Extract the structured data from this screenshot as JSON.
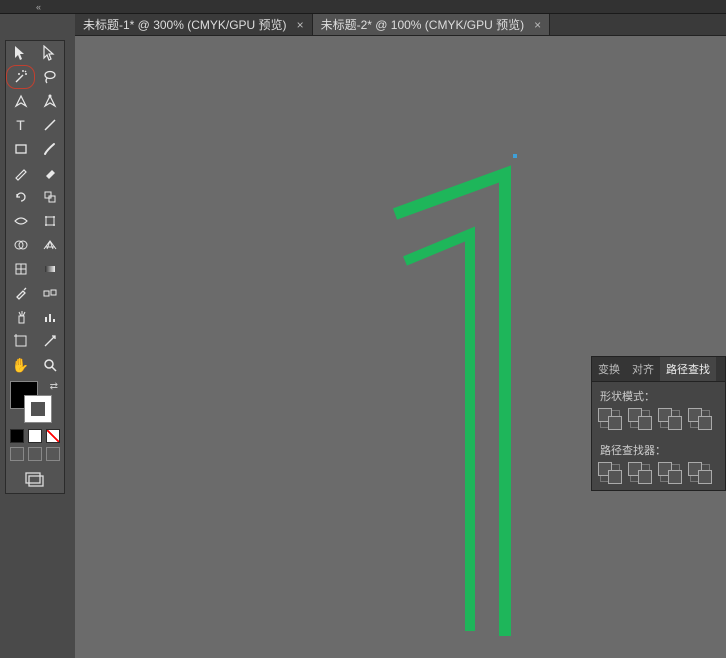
{
  "tabs": [
    {
      "label": "未标题-1* @ 300% (CMYK/GPU 预览)",
      "active": false
    },
    {
      "label": "未标题-2* @ 100% (CMYK/GPU 预览)",
      "active": true
    }
  ],
  "tools": {
    "selection": "selection-tool",
    "direct_select": "direct-selection-tool",
    "magic_wand": "magic-wand-tool",
    "lasso": "lasso-tool",
    "pen": "pen-tool",
    "curvature": "curvature-tool",
    "type": "type-tool",
    "line": "line-segment-tool",
    "rectangle": "rectangle-tool",
    "paintbrush": "paintbrush-tool",
    "pencil": "pencil-tool",
    "eraser": "eraser-tool",
    "rotate": "rotate-tool",
    "scale": "scale-tool",
    "width": "width-tool",
    "free_transform": "free-transform-tool",
    "shape_builder": "shape-builder-tool",
    "perspective": "perspective-grid-tool",
    "mesh": "mesh-tool",
    "gradient": "gradient-tool",
    "eyedropper": "eyedropper-tool",
    "blend": "blend-tool",
    "symbol_sprayer": "symbol-sprayer-tool",
    "graph": "column-graph-tool",
    "artboard": "artboard-tool",
    "slice": "slice-tool",
    "hand": "hand-tool",
    "zoom": "zoom-tool"
  },
  "swatch": {
    "fill": "#000000",
    "stroke": "none"
  },
  "panel": {
    "tabs": [
      "变换",
      "对齐",
      "路径查找"
    ],
    "active_tab": "路径查找",
    "shape_modes_label": "形状模式：",
    "pathfinders_label": "路径查找器："
  },
  "canvas": {
    "artwork": "two green polyline strokes forming a numeral 1 shape",
    "stroke_color": "#1eb65a"
  }
}
